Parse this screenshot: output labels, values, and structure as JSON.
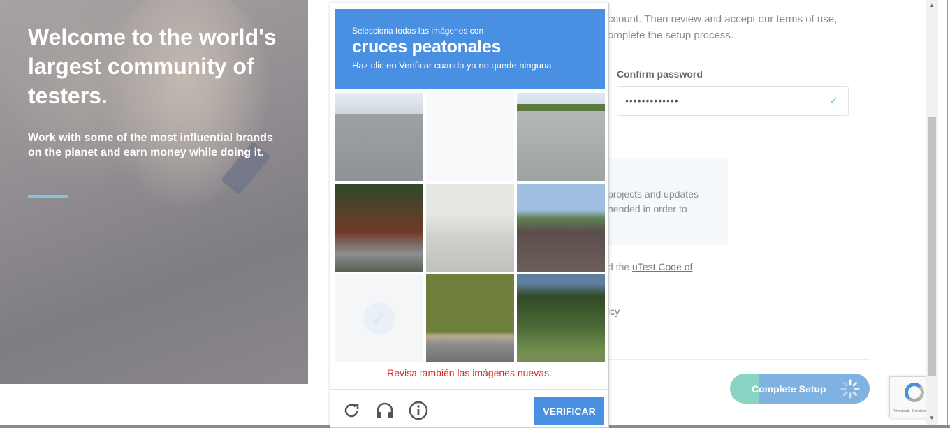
{
  "hero": {
    "title": "Welcome to the world's largest community of testers.",
    "subtitle": "Work with some of the most influential brands on the planet and earn money while doing it."
  },
  "form": {
    "intro_line1": "ccount. Then review and accept our terms of use,",
    "intro_line2": "omplete the setup process.",
    "confirm_password_label": "Confirm password",
    "confirm_password_value": "•••••••••••••",
    "info_line1": "projects and updates",
    "info_line2": "nended in order to",
    "code_prefix": "d the ",
    "code_link": "uTest Code of",
    "policy_link": "icy",
    "complete_button": "Complete Setup"
  },
  "captcha": {
    "instruction_small": "Selecciona todas las imágenes con",
    "instruction_big": "cruces peatonales",
    "instruction_hint": "Haz clic en Verificar cuando ya no quede ninguna.",
    "error": "Revisa también las imágenes nuevas.",
    "verify_button": "VERIFICAR",
    "icons": [
      "reload-icon",
      "audio-icon",
      "info-icon"
    ]
  },
  "badge": {
    "terms": "Privacidad - Condiciones"
  },
  "colors": {
    "captcha_blue": "#4a90e2",
    "error_red": "#d93025",
    "complete_teal": "#8ad4c4",
    "complete_blue": "#7fb2e0",
    "hero_accent": "#7fc6d6"
  }
}
